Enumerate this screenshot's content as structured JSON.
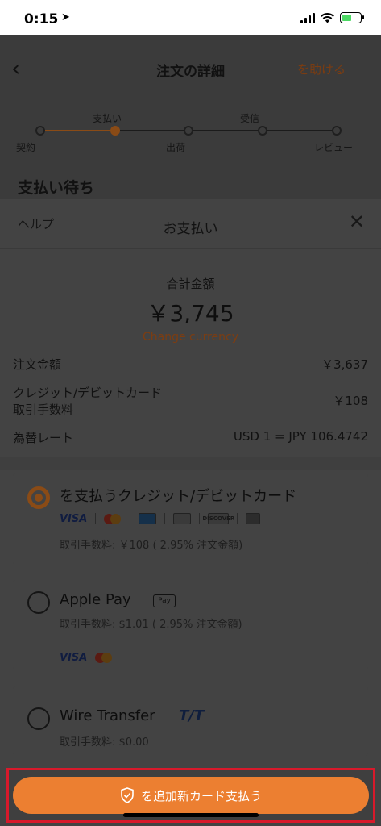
{
  "status_bar": {
    "time": "0:15",
    "location_glyph": "➤"
  },
  "background_page": {
    "back_glyph": "‹",
    "title": "注文の詳細",
    "help_link": "を助ける",
    "steps_top": [
      "支払い",
      "受信"
    ],
    "steps_bottom": [
      "契約",
      "出荷",
      "レビュー"
    ],
    "section_title": "支払い待ち"
  },
  "sheet": {
    "help_label": "ヘルプ",
    "title": "お支払い",
    "close_glyph": "✕",
    "total_label": "合計金額",
    "total_amount": "￥3,745",
    "change_currency": "Change currency",
    "rows": {
      "order_amount": {
        "label": "注文金額",
        "value": "￥3,637"
      },
      "card_fee": {
        "label_line1": "クレジット/デビットカード",
        "label_line2": "取引手数料",
        "value": "￥108"
      },
      "exchange_rate": {
        "label": "為替レート",
        "value": "USD 1 = JPY 106.4742"
      }
    },
    "options": {
      "card": {
        "title": "を支払うクレジット/デビットカード",
        "fee": "取引手数料: ￥108 ( 2.95% 注文金額)",
        "selected": true,
        "logos": [
          "VISA",
          "mastercard",
          "amex",
          "diners",
          "discover",
          "jcb"
        ]
      },
      "apple_pay": {
        "title": "Apple Pay",
        "badge": "Pay",
        "fee": "取引手数料: $1.01 ( 2.95% 注文金額)",
        "logos": [
          "VISA",
          "mastercard"
        ]
      },
      "wire": {
        "title": "Wire Transfer",
        "badge": "T/T",
        "fee": "取引手数料: $0.00"
      }
    }
  },
  "pay_button": {
    "label": "を追加新カード支払う",
    "icon": "shield-check-icon"
  },
  "colors": {
    "accent": "#ec7f31",
    "highlight_border": "#d8192b"
  }
}
